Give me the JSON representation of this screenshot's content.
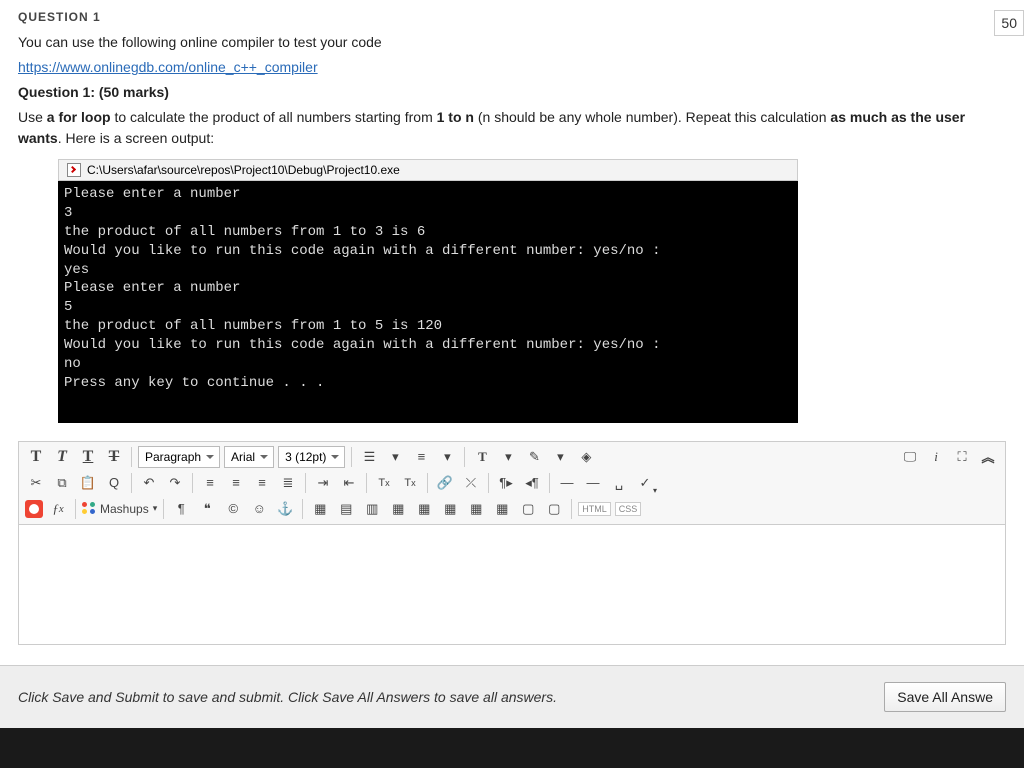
{
  "header": {
    "cut_label": "QUESTION 1",
    "points": "50"
  },
  "question": {
    "intro": "You can use the following online compiler to test your code",
    "link": "https://www.onlinegdb.com/online_c++_compiler",
    "title": "Question 1: (50 marks)",
    "line1_a": "Use ",
    "line1_b": "a for loop",
    "line1_c": " to calculate the product of all numbers starting from ",
    "line1_d": "1 to n",
    "line1_e": " (n should be any whole number). Repeat this calculation ",
    "line1_f": "as much as the user wants",
    "line1_g": ". Here is a screen output:"
  },
  "console": {
    "title": "C:\\Users\\afar\\source\\repos\\Project10\\Debug\\Project10.exe",
    "output": "Please enter a number\n3\nthe product of all numbers from 1 to 3 is 6\nWould you like to run this code again with a different number: yes/no :\nyes\nPlease enter a number\n5\nthe product of all numbers from 1 to 5 is 120\nWould you like to run this code again with a different number: yes/no :\nno\nPress any key to continue . . ."
  },
  "toolbar": {
    "format_sel": "Paragraph",
    "font_sel": "Arial",
    "size_sel": "3 (12pt)",
    "mashups": "Mashups",
    "html": "HTML",
    "css": "CSS"
  },
  "footer": {
    "hint": "Click Save and Submit to save and submit. Click Save All Answers to save all answers.",
    "save_all": "Save All Answe"
  }
}
